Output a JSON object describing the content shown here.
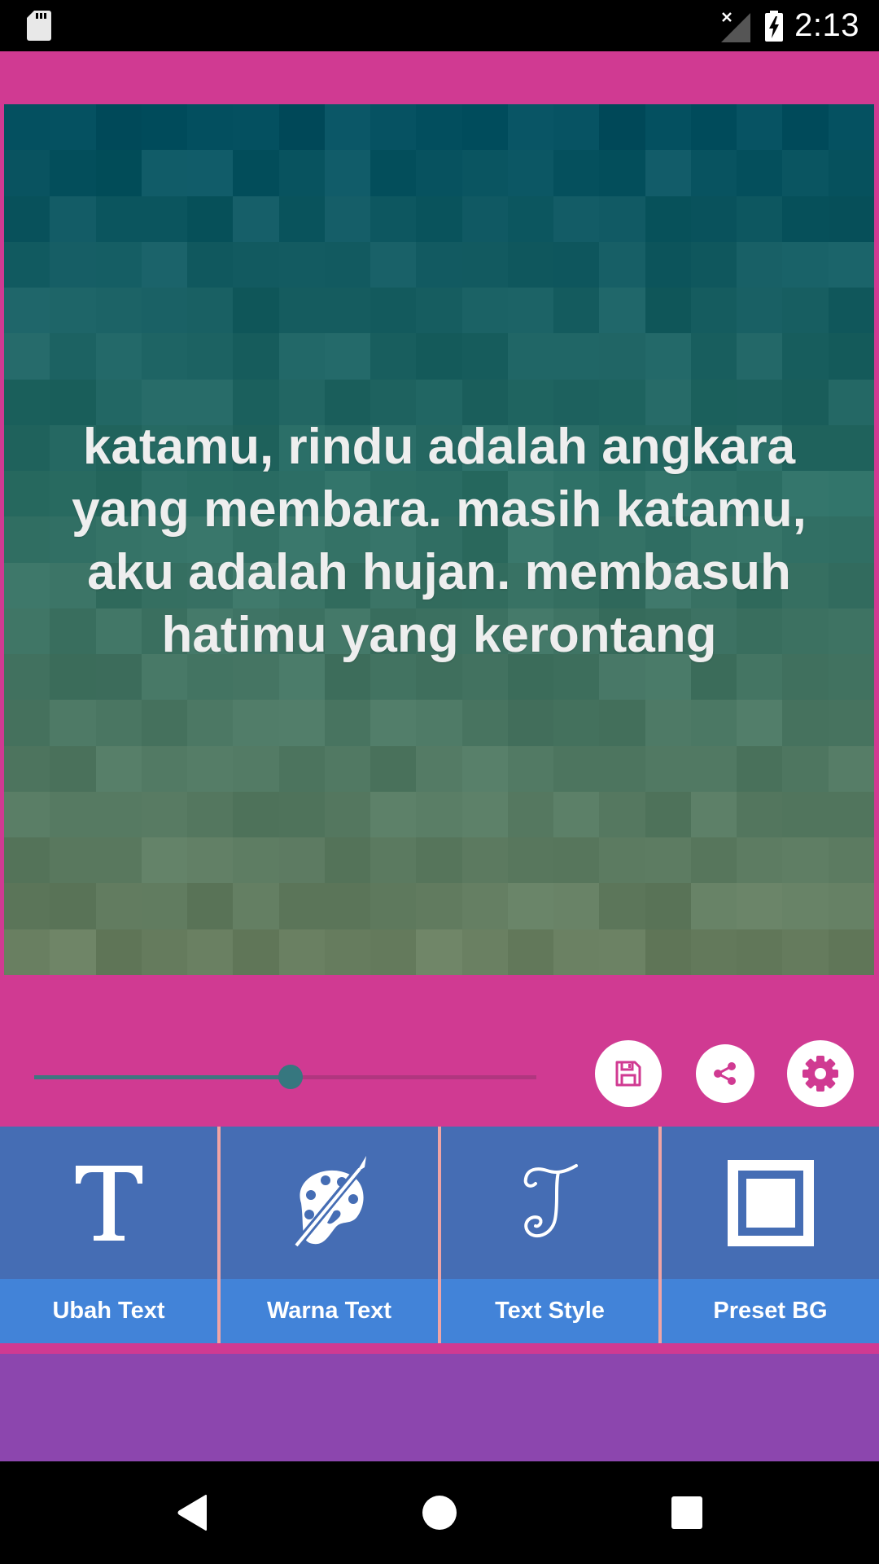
{
  "status_bar": {
    "time": "2:13",
    "icons": [
      "sd-card-icon",
      "no-signal-icon",
      "battery-charging-icon"
    ]
  },
  "canvas": {
    "quote_text": "katamu, rindu adalah angkara yang membara. masih katamu, aku adalah hujan. membasuh hatimu yang kerontang",
    "text_color": "#eeeeee",
    "background_style": "pixelated teal-to-olive mosaic gradient"
  },
  "controls": {
    "slider_value_percent": 51,
    "buttons": [
      {
        "name": "save",
        "icon": "floppy-disk-icon"
      },
      {
        "name": "share",
        "icon": "share-icon"
      },
      {
        "name": "settings",
        "icon": "gear-icon"
      }
    ]
  },
  "tools": [
    {
      "label": "Ubah Text",
      "icon": "text-t-icon"
    },
    {
      "label": "Warna Text",
      "icon": "palette-brush-icon"
    },
    {
      "label": "Text Style",
      "icon": "script-t-icon"
    },
    {
      "label": "Preset BG",
      "icon": "framed-square-icon"
    }
  ],
  "colors": {
    "app_background": "#d03a92",
    "tool_icon_bg": "#456db4",
    "tool_label_bg": "#4283d8",
    "tool_separator": "#f0a4a4",
    "footer_bg": "#8c46ae",
    "slider_active": "#3d7780",
    "slider_inactive": "#b0367f"
  },
  "nav_bar": {
    "buttons": [
      "back",
      "home",
      "recents"
    ]
  }
}
